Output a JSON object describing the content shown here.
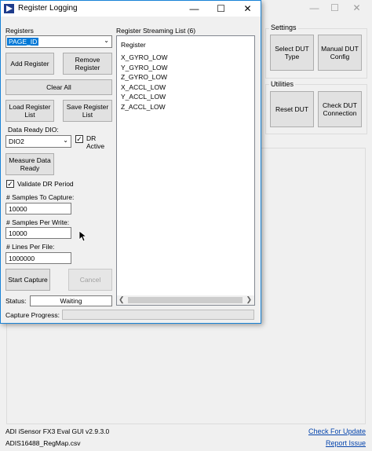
{
  "main_window": {
    "settings_group": {
      "title": "Settings",
      "select_dut_type": "Select DUT Type",
      "manual_dut_config": "Manual DUT Config"
    },
    "utilities_group": {
      "title": "Utilities",
      "reset_dut": "Reset DUT",
      "check_dut_connection": "Check DUT Connection"
    },
    "footer": {
      "version": "ADI iSensor FX3 Eval GUI v2.9.3.0",
      "regmap": "ADIS16488_RegMap.csv",
      "check_update": "Check For Update",
      "report_issue": "Report Issue"
    }
  },
  "dialog": {
    "title": "Register Logging",
    "registers_label": "Registers",
    "registers_selected": "PAGE_ID",
    "add_register": "Add Register",
    "remove_register": "Remove Register",
    "clear_all": "Clear All",
    "load_register_list": "Load Register List",
    "save_register_list": "Save Register List",
    "data_ready_dio_label": "Data Ready DIO:",
    "data_ready_dio_value": "DIO2",
    "dr_active_label": "DR Active",
    "measure_data_ready": "Measure Data Ready",
    "validate_dr_period": "Validate DR Period",
    "samples_to_capture_label": "# Samples To Capture:",
    "samples_to_capture": "10000",
    "samples_per_write_label": "# Samples Per Write:",
    "samples_per_write": "10000",
    "lines_per_file_label": "# Lines Per File:",
    "lines_per_file": "1000000",
    "start_capture": "Start Capture",
    "cancel": "Cancel",
    "status_label": "Status:",
    "status_value": "Waiting",
    "capture_progress_label": "Capture Progress:",
    "capture_progress": 0,
    "stream_list": {
      "title": "Register Streaming List (6)",
      "header": "Register",
      "items": [
        "X_GYRO_LOW",
        "Y_GYRO_LOW",
        "Z_GYRO_LOW",
        "X_ACCL_LOW",
        "Y_ACCL_LOW",
        "Z_ACCL_LOW"
      ]
    }
  }
}
